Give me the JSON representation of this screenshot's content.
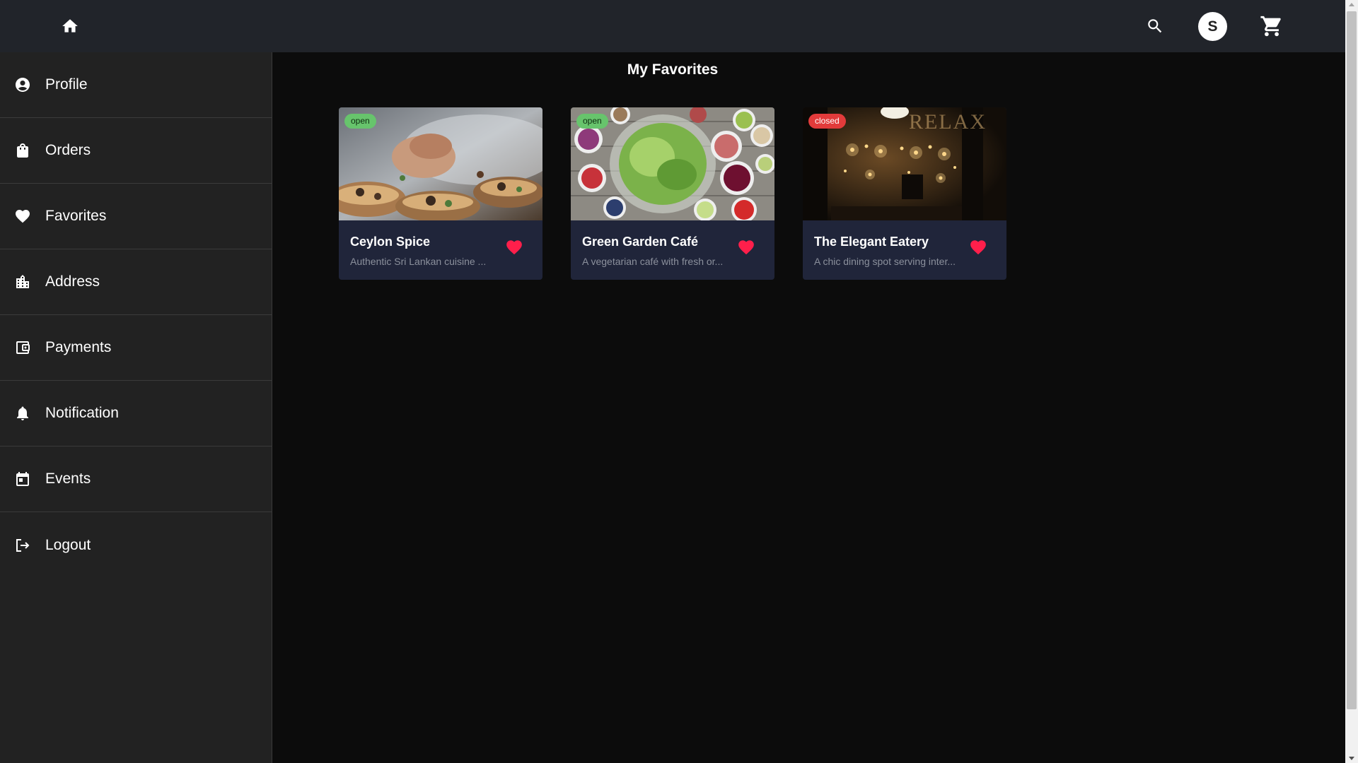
{
  "colors": {
    "topbar": "#21242a",
    "sidebar": "#222222",
    "background": "#0c0c0c",
    "card": "#20253a",
    "heart": "#ff1f4b",
    "open_badge": "#67c46c",
    "closed_badge": "#e23b3b"
  },
  "topbar": {
    "home_icon": "home-icon",
    "search_icon": "search-icon",
    "avatar_initial": "S",
    "cart_icon": "cart-icon"
  },
  "sidebar": {
    "items": [
      {
        "label": "Profile",
        "icon": "account-circle-icon"
      },
      {
        "label": "Orders",
        "icon": "shopping-bag-icon"
      },
      {
        "label": "Favorites",
        "icon": "heart-icon"
      },
      {
        "label": "Address",
        "icon": "location-city-icon"
      },
      {
        "label": "Payments",
        "icon": "wallet-icon"
      },
      {
        "label": "Notification",
        "icon": "bell-icon"
      },
      {
        "label": "Events",
        "icon": "calendar-icon"
      },
      {
        "label": "Logout",
        "icon": "logout-icon"
      }
    ]
  },
  "main": {
    "title": "My Favorites",
    "cards": [
      {
        "name": "Ceylon Spice",
        "description": "Authentic Sri Lankan cuisine ...",
        "status": "open",
        "image": "food-plating-photo"
      },
      {
        "name": "Green Garden Café",
        "description": "A vegetarian café with fresh or...",
        "status": "open",
        "image": "salad-bowls-photo"
      },
      {
        "name": "The Elegant Eatery",
        "description": "A chic dining spot serving inter...",
        "status": "closed",
        "image": "restaurant-interior-photo"
      }
    ]
  }
}
